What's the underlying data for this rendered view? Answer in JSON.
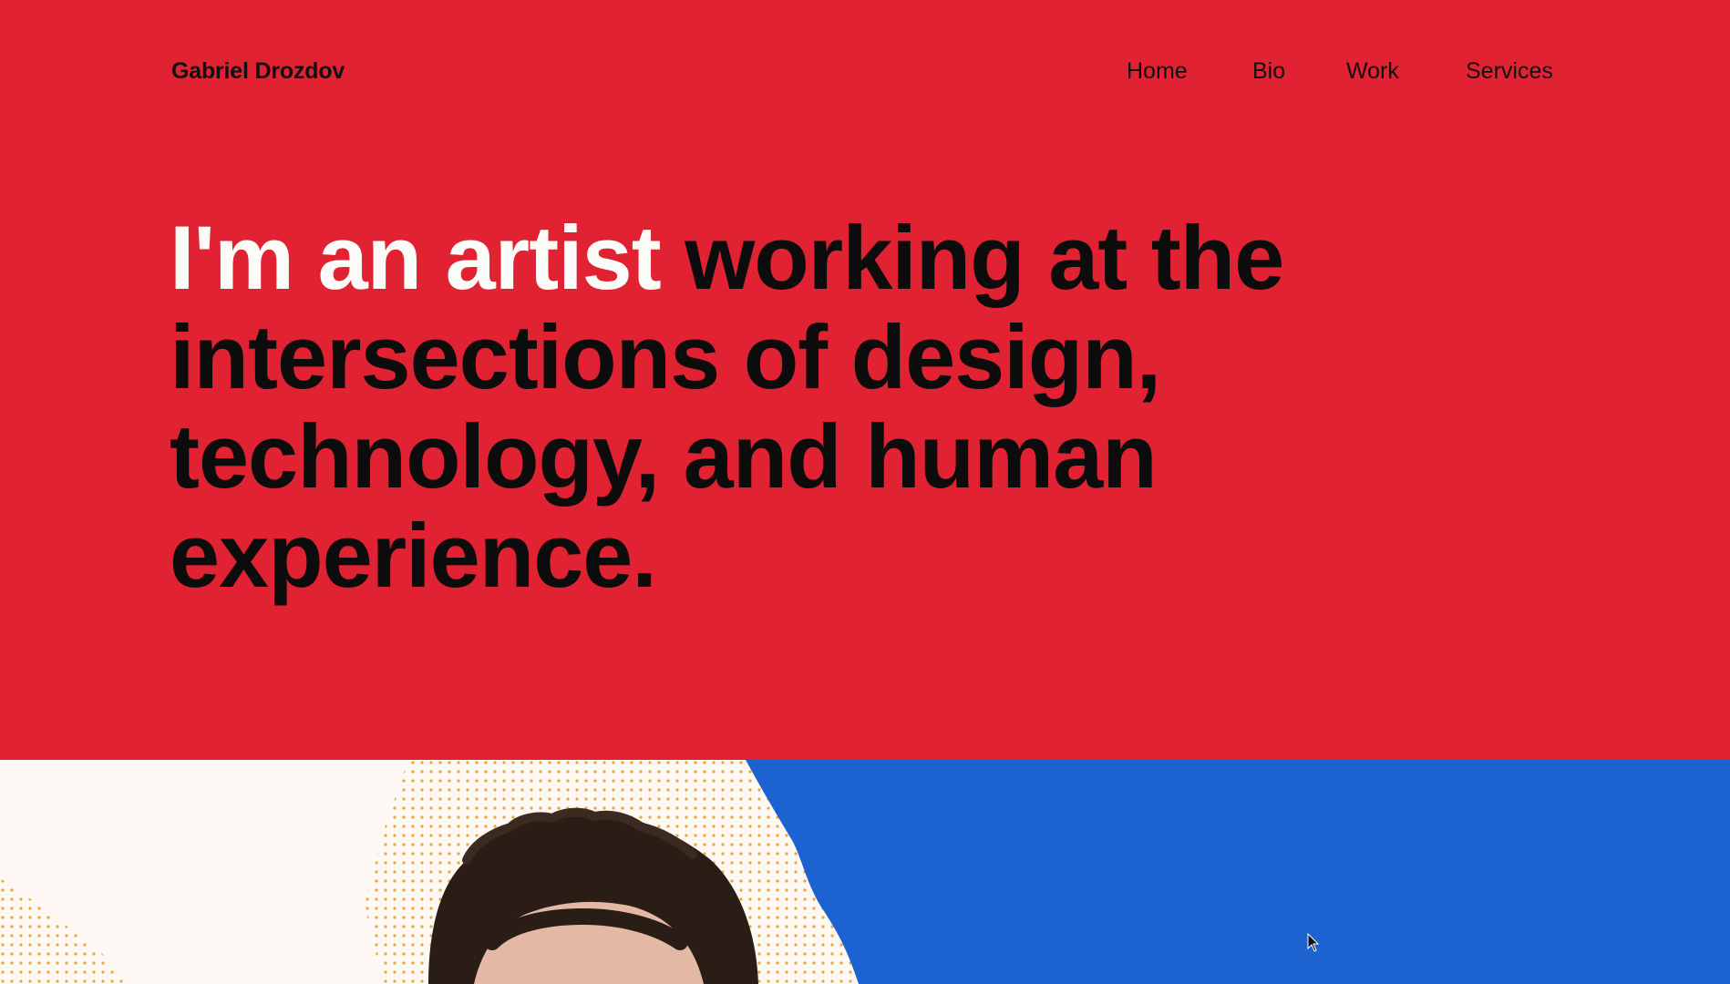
{
  "header": {
    "brand": "Gabriel Drozdov",
    "nav": [
      {
        "label": "Home"
      },
      {
        "label": "Bio"
      },
      {
        "label": "Work"
      },
      {
        "label": "Services"
      }
    ]
  },
  "hero": {
    "headline_accent": "I'm an artist",
    "headline_rest": " working at the intersections of design, technology, and human experience."
  },
  "colors": {
    "hero_background": "#e02232",
    "accent_text": "#fbfbf7",
    "blue_panel": "#1c63d1",
    "dot_pattern": "#e8a83a",
    "cream": "#fdf8f4"
  },
  "images": {
    "portrait": "portrait-photo"
  }
}
